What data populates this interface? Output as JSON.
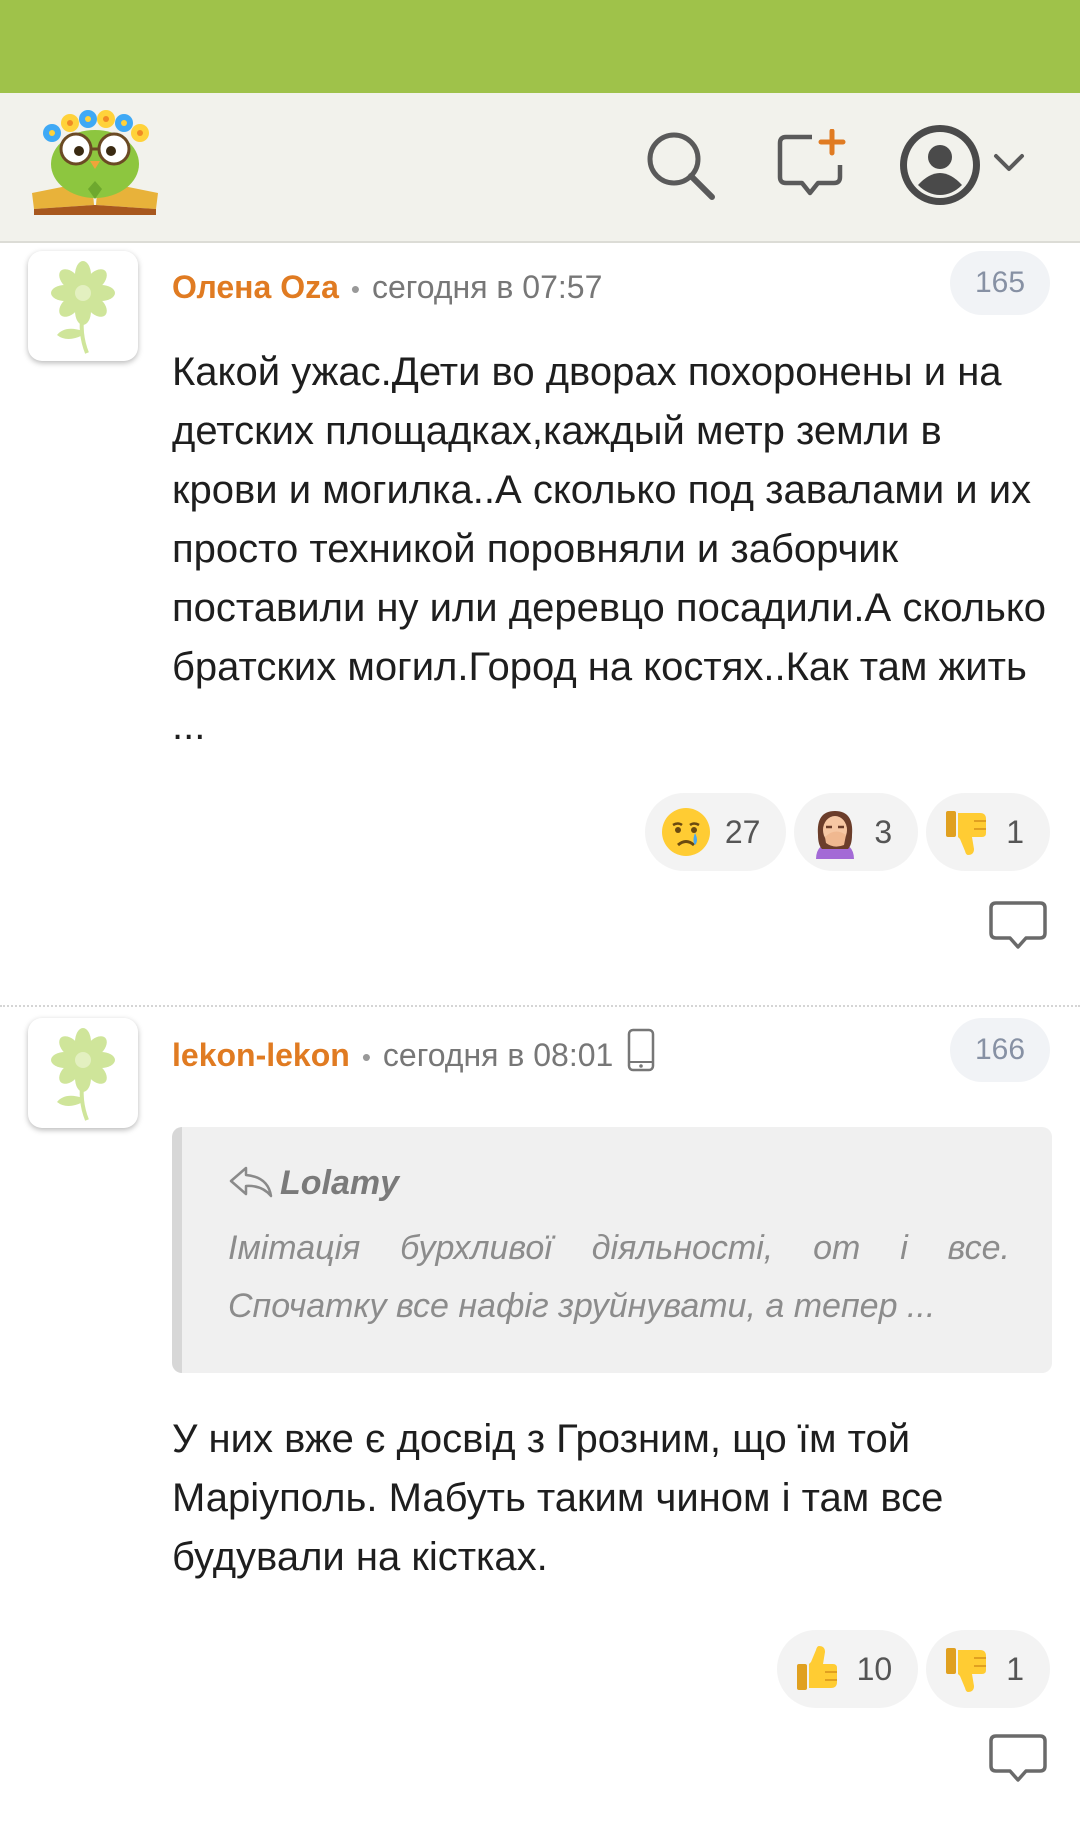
{
  "header": {
    "logo_icon": "owl-logo-icon",
    "search_icon": "search-icon",
    "new_message_icon": "new-message-icon",
    "avatar_icon": "user-avatar-icon",
    "dropdown_icon": "chevron-down-icon"
  },
  "colors": {
    "status_bar": "#9fc24a",
    "author": "#e07b22",
    "header_bg": "#f2f2ec"
  },
  "comments": [
    {
      "author": "Олена Oza",
      "time": "сегодня в 07:57",
      "number": "165",
      "text": "Какой ужас.Дети во дворах похоронены и на детских площадках,каждый метр земли в крови и могилка..А сколько под завалами и их просто техникой поровняли и заборчик поставили ну или деревцо посадили.А сколько братских могил.Город на костях..Как там жить ...",
      "reactions": [
        {
          "icon": "crying-face-icon",
          "count": "27"
        },
        {
          "icon": "facepalm-icon",
          "count": "3"
        },
        {
          "icon": "thumbs-down-icon",
          "count": "1"
        }
      ]
    },
    {
      "author": "lekon-lekon",
      "time": "сегодня в 08:01",
      "device_icon": "mobile-phone-icon",
      "number": "166",
      "quote": {
        "author": "Lolamy",
        "text": "Імітація бурхливої діяльності, от і все. Спочатку все нафіг зруйнувати, а тепер ..."
      },
      "text": "У них вже є досвід з Грозним, що їм той Маріуполь. Мабуть таким чином і там все будували на кістках.",
      "reactions": [
        {
          "icon": "thumbs-up-icon",
          "count": "10"
        },
        {
          "icon": "thumbs-down-icon",
          "count": "1"
        }
      ]
    }
  ]
}
